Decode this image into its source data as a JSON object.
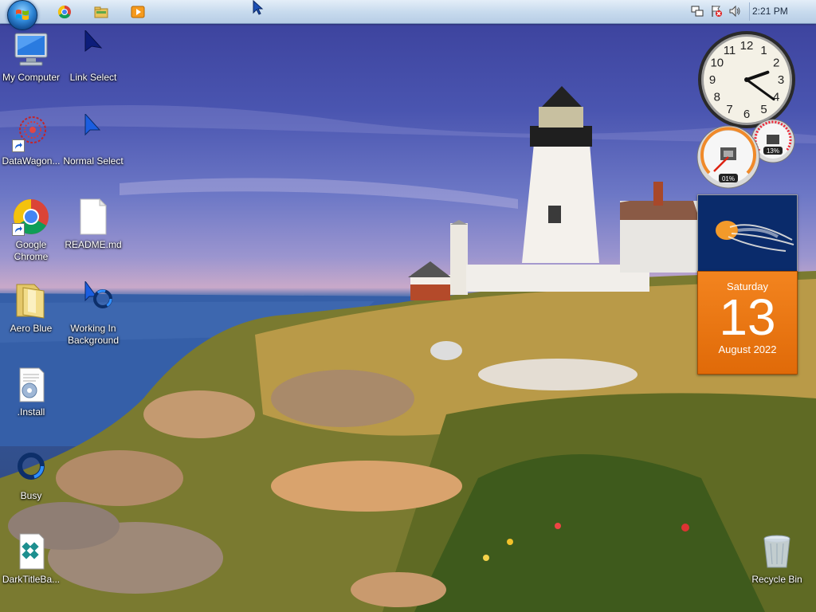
{
  "taskbar": {
    "pinned": [
      "chrome-icon",
      "explorer-icon",
      "media-player-icon"
    ],
    "tray": {
      "time": "2:21 PM",
      "icons": [
        "network-icon",
        "action-center-icon",
        "volume-icon"
      ]
    }
  },
  "desktop": {
    "icons": [
      {
        "label": "My Computer",
        "icon": "computer-icon"
      },
      {
        "label": "Link Select",
        "icon": "link-select-cursor-icon"
      },
      {
        "label": "DataWagon...",
        "icon": "datawagon-icon"
      },
      {
        "label": "Normal Select",
        "icon": "normal-select-cursor-icon"
      },
      {
        "label": "Google Chrome",
        "icon": "chrome-icon"
      },
      {
        "label": "README.md",
        "icon": "file-icon"
      },
      {
        "label": "Aero Blue",
        "icon": "folder-icon"
      },
      {
        "label": "Working In Background",
        "icon": "working-cursor-icon"
      },
      {
        "label": ".Install",
        "icon": "install-icon"
      },
      {
        "label": "Busy",
        "icon": "busy-cursor-icon"
      },
      {
        "label": "DarkTitleBa...",
        "icon": "app-icon"
      },
      {
        "label": "Recycle Bin",
        "icon": "recycle-bin-icon"
      }
    ]
  },
  "gadgets": {
    "clock": {
      "hour": 2,
      "minute": 21
    },
    "cpu": {
      "cpu_percent": "01%",
      "memory_percent": "13%"
    },
    "calendar": {
      "weekday": "Saturday",
      "day": "13",
      "month_year": "August 2022"
    }
  },
  "colors": {
    "calendar": "#f07818",
    "taskbar": "#c8dbee"
  }
}
